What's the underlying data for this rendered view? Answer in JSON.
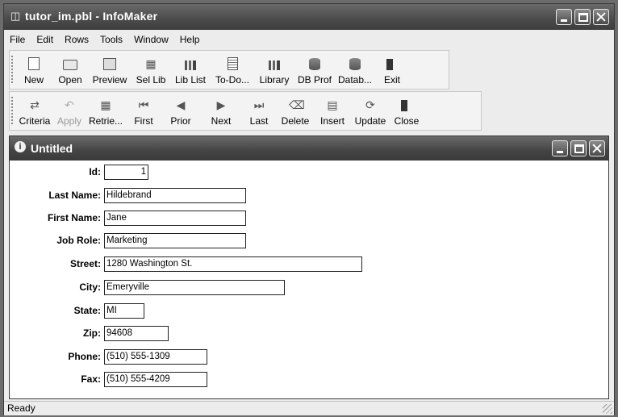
{
  "window": {
    "title": "tutor_im.pbl - InfoMaker"
  },
  "menu": [
    "File",
    "Edit",
    "Rows",
    "Tools",
    "Window",
    "Help"
  ],
  "toolbar1": [
    {
      "label": "New",
      "icon": "new-icon"
    },
    {
      "label": "Open",
      "icon": "open-folder-icon"
    },
    {
      "label": "Preview",
      "icon": "preview-icon"
    },
    {
      "label": "Sel Lib",
      "icon": "select-library-icon"
    },
    {
      "label": "Lib List",
      "icon": "library-list-icon"
    },
    {
      "label": "To-Do...",
      "icon": "todo-list-icon"
    },
    {
      "label": "Library",
      "icon": "library-icon"
    },
    {
      "label": "DB Prof",
      "icon": "db-profile-icon"
    },
    {
      "label": "Datab...",
      "icon": "database-icon"
    },
    {
      "label": "Exit",
      "icon": "exit-icon"
    }
  ],
  "toolbar2": [
    {
      "label": "Criteria",
      "icon": "criteria-icon",
      "enabled": true
    },
    {
      "label": "Apply",
      "icon": "apply-icon",
      "enabled": false
    },
    {
      "label": "Retrie...",
      "icon": "retrieve-icon",
      "enabled": true
    },
    {
      "label": "First",
      "icon": "first-record-icon",
      "enabled": true
    },
    {
      "label": "Prior",
      "icon": "prior-record-icon",
      "enabled": true
    },
    {
      "label": "Next",
      "icon": "next-record-icon",
      "enabled": true
    },
    {
      "label": "Last",
      "icon": "last-record-icon",
      "enabled": true
    },
    {
      "label": "Delete",
      "icon": "delete-icon",
      "enabled": true
    },
    {
      "label": "Insert",
      "icon": "insert-icon",
      "enabled": true
    },
    {
      "label": "Update",
      "icon": "update-icon",
      "enabled": true
    },
    {
      "label": "Close",
      "icon": "close-icon",
      "enabled": true
    }
  ],
  "document": {
    "title": "Untitled"
  },
  "form": {
    "id": {
      "label": "Id:",
      "value": "1"
    },
    "last_name": {
      "label": "Last Name:",
      "value": "Hildebrand"
    },
    "first_name": {
      "label": "First Name:",
      "value": "Jane"
    },
    "job_role": {
      "label": "Job Role:",
      "value": "Marketing"
    },
    "street": {
      "label": "Street:",
      "value": "1280 Washington St."
    },
    "city": {
      "label": "City:",
      "value": "Emeryville"
    },
    "state": {
      "label": "State:",
      "value": "MI"
    },
    "zip": {
      "label": "Zip:",
      "value": "94608"
    },
    "phone": {
      "label": "Phone:",
      "value": "(510) 555-1309"
    },
    "fax": {
      "label": "Fax:",
      "value": "(510) 555-4209"
    }
  },
  "status": {
    "text": "Ready"
  },
  "colors": {
    "titlebar": "#4a4a4a",
    "chrome": "#ececec",
    "field_border": "#222222"
  }
}
